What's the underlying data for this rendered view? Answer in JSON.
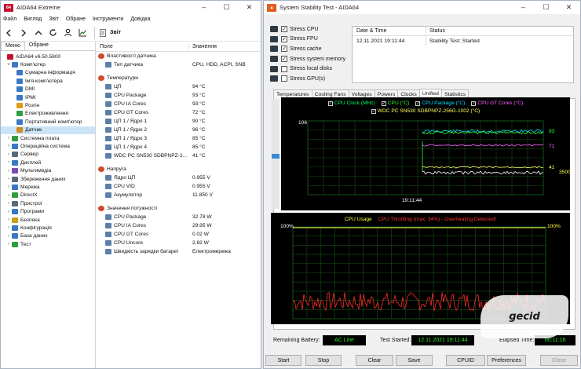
{
  "aida": {
    "title": "AIDA64 Extreme",
    "menu": [
      "Файл",
      "Вигляд",
      "Звіт",
      "Обране",
      "Інструменти",
      "Довідка"
    ],
    "breadcrumb": "Звіт",
    "tabs": [
      "Меню",
      "Обране"
    ],
    "tree": [
      {
        "label": "AIDA64 v6.50.5800",
        "indent": 0,
        "arrow": "",
        "color": "#c8102e"
      },
      {
        "label": "Комп'ютер",
        "indent": 1,
        "arrow": "˅",
        "color": "#3a78c4"
      },
      {
        "label": "Сумарна інформація",
        "indent": 2,
        "arrow": "",
        "color": "#3a78c4"
      },
      {
        "label": "Ім'я комп'ютера",
        "indent": 2,
        "arrow": "",
        "color": "#3a78c4"
      },
      {
        "label": "DMI",
        "indent": 2,
        "arrow": "",
        "color": "#3a78c4"
      },
      {
        "label": "IPMI",
        "indent": 2,
        "arrow": "",
        "color": "#3a78c4"
      },
      {
        "label": "Розгін",
        "indent": 2,
        "arrow": "",
        "color": "#e09a1a"
      },
      {
        "label": "Електроживлення",
        "indent": 2,
        "arrow": "",
        "color": "#2e9e3e"
      },
      {
        "label": "Портативний комп'ютер",
        "indent": 2,
        "arrow": "",
        "color": "#3a78c4"
      },
      {
        "label": "Датчик",
        "indent": 2,
        "arrow": "",
        "color": "#d08a1a",
        "selected": true
      },
      {
        "label": "Системна плата",
        "indent": 1,
        "arrow": "›",
        "color": "#2e9e3e"
      },
      {
        "label": "Операційна система",
        "indent": 1,
        "arrow": "›",
        "color": "#3a78c4"
      },
      {
        "label": "Сервер",
        "indent": 1,
        "arrow": "›",
        "color": "#5a6a7a"
      },
      {
        "label": "Дисплей",
        "indent": 1,
        "arrow": "›",
        "color": "#3a78c4"
      },
      {
        "label": "Мультимедіа",
        "indent": 1,
        "arrow": "›",
        "color": "#7a4ab0"
      },
      {
        "label": "Збереження даних",
        "indent": 1,
        "arrow": "›",
        "color": "#5a6a7a"
      },
      {
        "label": "Мережа",
        "indent": 1,
        "arrow": "›",
        "color": "#3a78c4"
      },
      {
        "label": "DirectX",
        "indent": 1,
        "arrow": "›",
        "color": "#2e9e3e"
      },
      {
        "label": "Пристрої",
        "indent": 1,
        "arrow": "›",
        "color": "#5a6a7a"
      },
      {
        "label": "Програми",
        "indent": 1,
        "arrow": "›",
        "color": "#3a78c4"
      },
      {
        "label": "Безпека",
        "indent": 1,
        "arrow": "›",
        "color": "#c8a01a"
      },
      {
        "label": "Конфігурація",
        "indent": 1,
        "arrow": "›",
        "color": "#3a78c4"
      },
      {
        "label": "База даних",
        "indent": 1,
        "arrow": "›",
        "color": "#3a78c4"
      },
      {
        "label": "Тест",
        "indent": 1,
        "arrow": "›",
        "color": "#2e9e3e"
      }
    ],
    "columns": {
      "field": "Поле",
      "value": "Значення"
    },
    "rows": [
      {
        "field": "Властивості датчика",
        "value": "",
        "section": true
      },
      {
        "field": "Тип датчика",
        "value": "CPU, HDD, ACPI, SNB"
      },
      {
        "gap": true
      },
      {
        "field": "Температури",
        "value": "",
        "section": true
      },
      {
        "field": "ЦП",
        "value": "94 °C"
      },
      {
        "field": "CPU Package",
        "value": "93 °C"
      },
      {
        "field": "CPU IA Cores",
        "value": "93 °C"
      },
      {
        "field": "CPU GT Cores",
        "value": "72 °C"
      },
      {
        "field": "ЦП 1 / Ядро 1",
        "value": "90 °C"
      },
      {
        "field": "ЦП 1 / Ядро 2",
        "value": "96 °C"
      },
      {
        "field": "ЦП 1 / Ядро 3",
        "value": "85 °C"
      },
      {
        "field": "ЦП 1 / Ядро 4",
        "value": "85 °C"
      },
      {
        "field": "WDC PC SN530 SDBPNPZ-2...",
        "value": "41 °C"
      },
      {
        "gap": true
      },
      {
        "field": "Напруга",
        "value": "",
        "section": true
      },
      {
        "field": "Ядро ЦП",
        "value": "0.955 V"
      },
      {
        "field": "CPU VID",
        "value": "0.955 V"
      },
      {
        "field": "Акумулятор",
        "value": "11.850 V"
      },
      {
        "gap": true
      },
      {
        "field": "Значення потужності",
        "value": "",
        "section": true
      },
      {
        "field": "CPU Package",
        "value": "32.78 W"
      },
      {
        "field": "CPU IA Cores",
        "value": "29.95 W"
      },
      {
        "field": "CPU GT Cores",
        "value": "0.02 W"
      },
      {
        "field": "CPU Uncore",
        "value": "2.82 W"
      },
      {
        "field": "Швидкість зарядки батареї",
        "value": "Електромережа"
      }
    ]
  },
  "sst": {
    "title": "System Stability Test - AIDA64",
    "stress": [
      {
        "label": "Stress CPU",
        "checked": true
      },
      {
        "label": "Stress FPU",
        "checked": true
      },
      {
        "label": "Stress cache",
        "checked": true
      },
      {
        "label": "Stress system memory",
        "checked": true
      },
      {
        "label": "Stress local disks",
        "checked": false
      },
      {
        "label": "Stress GPU(s)",
        "checked": false
      }
    ],
    "log": {
      "headers": [
        "Date & Time",
        "Status"
      ],
      "rows": [
        [
          "12.11.2021 19:11:44",
          "Stability Test: Started"
        ]
      ]
    },
    "tabs": [
      "Temperatures",
      "Cooling Fans",
      "Voltages",
      "Powers",
      "Clocks",
      "Unified",
      "Statistics"
    ],
    "active_tab": "Unified",
    "temp_graph": {
      "legend": [
        {
          "label": "CPU Clock (MHz)",
          "color": "#00ff66",
          "checked": true
        },
        {
          "label": "CPU (°C)",
          "color": "#33ff33",
          "checked": true
        },
        {
          "label": "CPU Package (°C)",
          "color": "#00e5ff",
          "checked": true
        },
        {
          "label": "CPU GT Cores (°C)",
          "color": "#ff66ff",
          "checked": true
        },
        {
          "label": "WDC PC SN530 SDBPNPZ-256G-1002 (°C)",
          "color": "#ffff66",
          "checked": true
        }
      ],
      "y_top": "106",
      "time_label": "19:11:44",
      "right_labels": [
        {
          "text": "93",
          "color": "#33ff33"
        },
        {
          "text": "71",
          "color": "#ff66ff"
        },
        {
          "text": "41",
          "color": "#ffff66"
        },
        {
          "text": "3500",
          "color": "#ffff66"
        }
      ]
    },
    "cpu_graph": {
      "title": "CPU Usage",
      "throttle": "CPU Throttling (max: 34%) - Overheating Detected!",
      "y_top_left": "100%",
      "y_top_right": "100%"
    },
    "status": {
      "battery_label": "Remaining Battery:",
      "battery_value": "AC Line",
      "started_label": "Test Started:",
      "started_value": "12.11.2021 19:11:44",
      "elapsed_label": "Elapsed Time:",
      "elapsed_value": "00:11:16"
    },
    "buttons": [
      "Start",
      "Stop",
      "Clear",
      "Save",
      "CPUID",
      "Preferences",
      "Close"
    ]
  },
  "watermark": "gecid"
}
